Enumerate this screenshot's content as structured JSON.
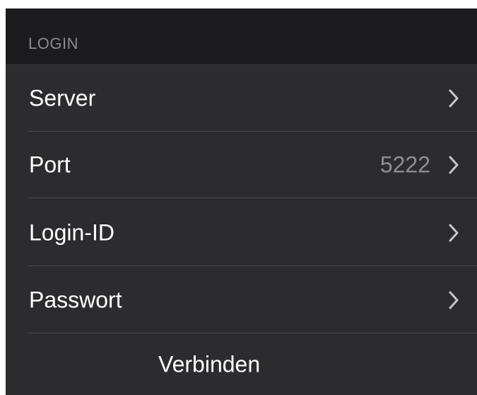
{
  "section": {
    "header": "LOGIN"
  },
  "rows": [
    {
      "label": "Server",
      "detail": "",
      "icon": "chevron-right-icon"
    },
    {
      "label": "Port",
      "detail": "5222",
      "icon": "chevron-right-icon"
    },
    {
      "label": "Login-ID",
      "detail": "",
      "icon": "chevron-right-icon"
    },
    {
      "label": "Passwort",
      "detail": "",
      "icon": "chevron-right-icon"
    }
  ],
  "action": {
    "label": "Verbinden"
  },
  "colors": {
    "background": "#1c1c1e",
    "cell": "#2c2c2e",
    "text": "#ffffff",
    "secondary_text": "#8e8e93",
    "separator": "#48484a",
    "chevron": "#c7c7cc"
  }
}
